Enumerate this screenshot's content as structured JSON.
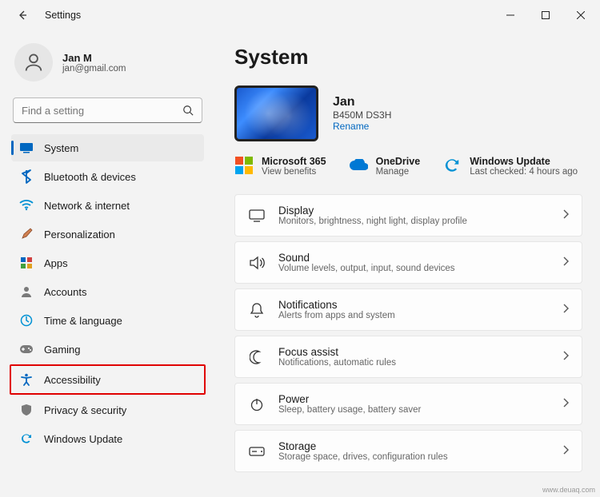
{
  "window": {
    "title": "Settings"
  },
  "profile": {
    "name": "Jan M",
    "email": "jan@gmail.com"
  },
  "search": {
    "placeholder": "Find a setting"
  },
  "sidebar": {
    "items": [
      {
        "icon": "system",
        "label": "System",
        "selected": true
      },
      {
        "icon": "bluetooth",
        "label": "Bluetooth & devices",
        "selected": false
      },
      {
        "icon": "network",
        "label": "Network & internet",
        "selected": false
      },
      {
        "icon": "personalize",
        "label": "Personalization",
        "selected": false
      },
      {
        "icon": "apps",
        "label": "Apps",
        "selected": false
      },
      {
        "icon": "accounts",
        "label": "Accounts",
        "selected": false
      },
      {
        "icon": "time",
        "label": "Time & language",
        "selected": false
      },
      {
        "icon": "gaming",
        "label": "Gaming",
        "selected": false
      },
      {
        "icon": "accessibility",
        "label": "Accessibility",
        "selected": false,
        "highlighted": true
      },
      {
        "icon": "privacy",
        "label": "Privacy & security",
        "selected": false
      },
      {
        "icon": "update",
        "label": "Windows Update",
        "selected": false
      }
    ]
  },
  "main": {
    "heading": "System",
    "device": {
      "name": "Jan",
      "model": "B450M DS3H",
      "rename": "Rename"
    },
    "quick": {
      "ms365": {
        "title": "Microsoft 365",
        "sub": "View benefits"
      },
      "onedrive": {
        "title": "OneDrive",
        "sub": "Manage"
      },
      "update": {
        "title": "Windows Update",
        "sub": "Last checked: 4 hours ago"
      }
    },
    "cards": [
      {
        "icon": "display",
        "title": "Display",
        "sub": "Monitors, brightness, night light, display profile"
      },
      {
        "icon": "sound",
        "title": "Sound",
        "sub": "Volume levels, output, input, sound devices"
      },
      {
        "icon": "bell",
        "title": "Notifications",
        "sub": "Alerts from apps and system"
      },
      {
        "icon": "moon",
        "title": "Focus assist",
        "sub": "Notifications, automatic rules"
      },
      {
        "icon": "power",
        "title": "Power",
        "sub": "Sleep, battery usage, battery saver"
      },
      {
        "icon": "storage",
        "title": "Storage",
        "sub": "Storage space, drives, configuration rules"
      }
    ]
  },
  "watermark": "www.deuaq.com"
}
